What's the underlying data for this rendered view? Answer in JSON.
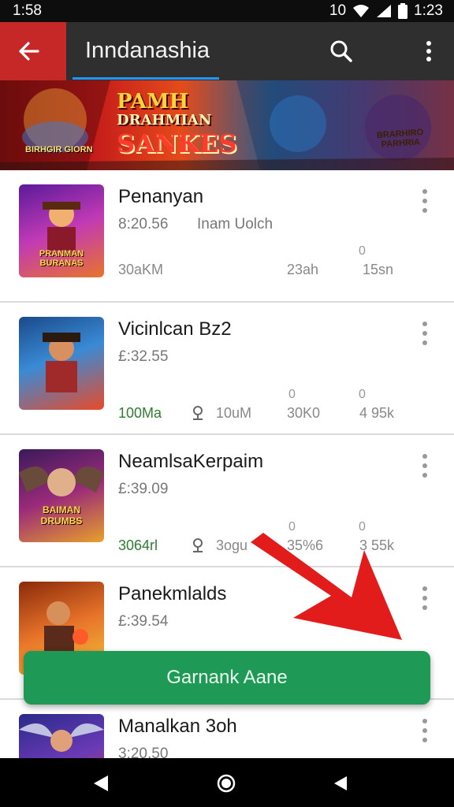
{
  "status_bar": {
    "time": "1:58",
    "right_text": "10",
    "clock_right": "1:23"
  },
  "app_bar": {
    "title": "Inndanashia"
  },
  "banner": {
    "title_line1": "PAMH",
    "title_line2": "DRAHMIAN",
    "title_line3": "SANKES",
    "left_badge": "BIRHGIR GIORN",
    "right_badge": "BRARHIRO PARHRIA"
  },
  "cards": [
    {
      "title": "Penanyan",
      "price": "8:20.56",
      "subtitle": "Inam Uolch",
      "stats": {
        "left": "30aKM",
        "mid": "23ah",
        "right": "15sn",
        "zero1": "0"
      },
      "thumb": "PRANMAN BURANAS"
    },
    {
      "title": "Vicinlcan Bz2",
      "price": "£:32.55",
      "stats": {
        "green": "100Ma",
        "search": "10uM",
        "col3": "30K0",
        "col4": "4 95k",
        "zero1": "0",
        "zero2": "0"
      },
      "thumb": ""
    },
    {
      "title": "NeamlsaKerpaim",
      "price": "£:39.09",
      "stats": {
        "green": "3064rl",
        "search": "3ogu",
        "col3": "35%6",
        "col4": "3 55k",
        "zero1": "0",
        "zero2": "0"
      },
      "thumb": "BAIMAN DRUMBS"
    },
    {
      "title": "Panekmlalds",
      "price": "£:39.54",
      "thumb": ""
    },
    {
      "title": "Manalkan 3oh",
      "price": "3:20.50",
      "thumb": ""
    }
  ],
  "cta": {
    "label": "Garnank Aane"
  },
  "colors": {
    "accent_red": "#c62828",
    "appbar": "#2f2f2f",
    "cta_green": "#1f9a56",
    "arrow_red": "#e21b1b"
  }
}
